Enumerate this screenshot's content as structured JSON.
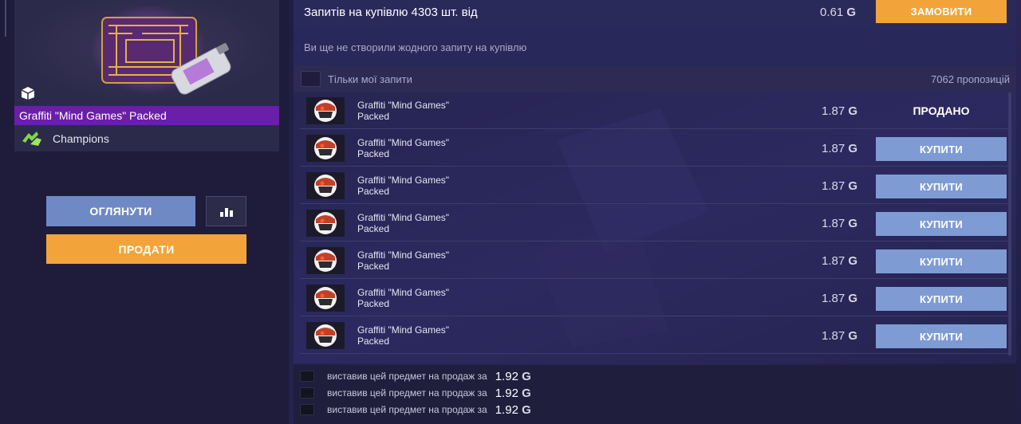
{
  "item": {
    "name": "Graffiti \"Mind Games\" Packed",
    "collection": "Champions",
    "image_icon": "mind-games-graffiti-image",
    "box_icon": "package-icon"
  },
  "actions": {
    "inspect_label": "ОГЛЯНУТИ",
    "sell_label": "ПРОДАТИ",
    "stats_icon": "bar-chart-icon"
  },
  "buy_orders": {
    "title": "Запитів на купівлю 4303 шт. від",
    "price": "0.61",
    "order_label": "ЗАМОВИТИ",
    "empty_message": "Ви ще не створили жодного запиту на купівлю"
  },
  "filter": {
    "label": "Тільки мої запити",
    "offers_count": "7062 пропозицій"
  },
  "currency_symbol": "G",
  "listings": [
    {
      "name_line1": "Graffiti \"Mind Games\"",
      "name_line2": "Packed",
      "price": "1.87",
      "action": "ПРОДАНО",
      "sold": true
    },
    {
      "name_line1": "Graffiti \"Mind Games\"",
      "name_line2": "Packed",
      "price": "1.87",
      "action": "КУПИТИ",
      "sold": false
    },
    {
      "name_line1": "Graffiti \"Mind Games\"",
      "name_line2": "Packed",
      "price": "1.87",
      "action": "КУПИТИ",
      "sold": false
    },
    {
      "name_line1": "Graffiti \"Mind Games\"",
      "name_line2": "Packed",
      "price": "1.87",
      "action": "КУПИТИ",
      "sold": false
    },
    {
      "name_line1": "Graffiti \"Mind Games\"",
      "name_line2": "Packed",
      "price": "1.87",
      "action": "КУПИТИ",
      "sold": false
    },
    {
      "name_line1": "Graffiti \"Mind Games\"",
      "name_line2": "Packed",
      "price": "1.87",
      "action": "КУПИТИ",
      "sold": false
    },
    {
      "name_line1": "Graffiti \"Mind Games\"",
      "name_line2": "Packed",
      "price": "1.87",
      "action": "КУПИТИ",
      "sold": false
    }
  ],
  "history": [
    {
      "text": "виставив цей предмет на продаж за",
      "price": "1.92"
    },
    {
      "text": "виставив цей предмет на продаж за",
      "price": "1.92"
    },
    {
      "text": "виставив цей предмет на продаж за",
      "price": "1.92"
    }
  ],
  "colors": {
    "accent_orange": "#f2a43a",
    "buy_blue": "#7f9bd4",
    "item_purple": "#6a1fa8"
  }
}
